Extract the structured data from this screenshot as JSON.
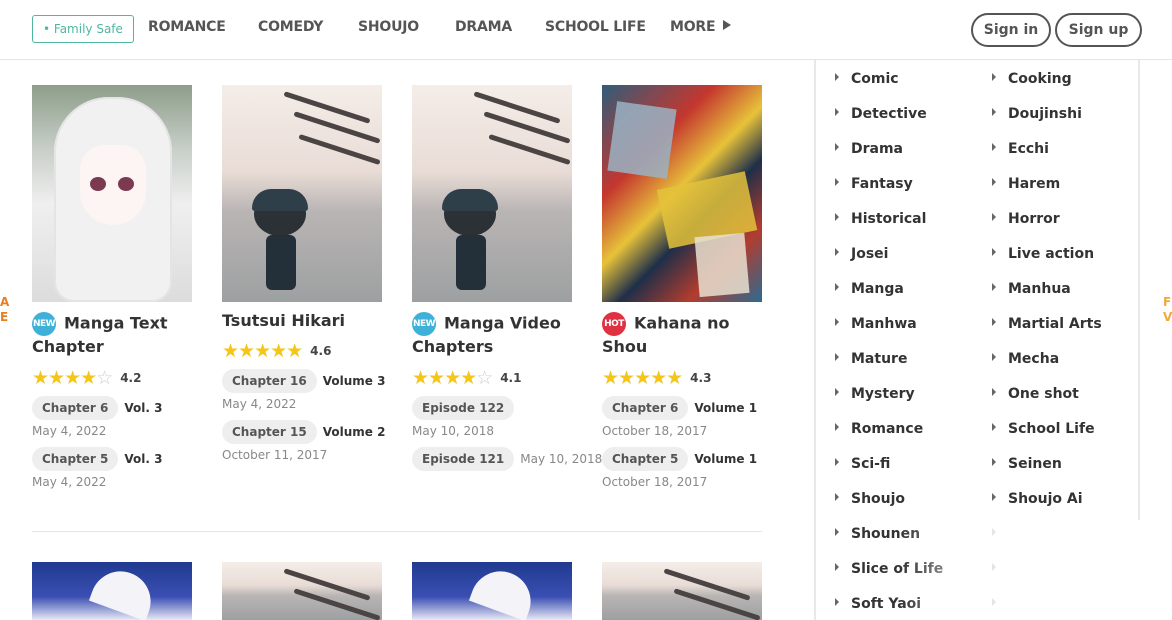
{
  "header": {
    "family_safe": "• Family Safe",
    "nav": [
      "ROMANCE",
      "COMEDY",
      "SHOUJO",
      "DRAMA",
      "SCHOOL LIFE",
      "MORE"
    ],
    "sign_in": "Sign in",
    "sign_up": "Sign up"
  },
  "side_text": {
    "left": [
      "A",
      "E"
    ],
    "right": [
      "F",
      "V"
    ]
  },
  "cards": [
    {
      "badge": "NEW",
      "title": "Manga Text Chapter",
      "rating": 4.2,
      "rating_text": "4.2",
      "chapters": [
        {
          "chip": "Chapter 6",
          "volume": "Vol. 3",
          "date": "May 4, 2022"
        },
        {
          "chip": "Chapter 5",
          "volume": "Vol. 3",
          "date": "May 4, 2022"
        }
      ]
    },
    {
      "badge": "",
      "title": "Tsutsui Hikari",
      "rating": 4.6,
      "rating_text": "4.6",
      "chapters": [
        {
          "chip": "Chapter 16",
          "volume": "Volume 3",
          "date": "May 4, 2022"
        },
        {
          "chip": "Chapter 15",
          "volume": "Volume 2",
          "date": "October 11, 2017"
        }
      ]
    },
    {
      "badge": "NEW",
      "title": "Manga Video Chapters",
      "rating": 4.1,
      "rating_text": "4.1",
      "chapters": [
        {
          "chip": "Episode 122",
          "volume": "",
          "date": "May 10, 2018"
        },
        {
          "chip": "Episode 121",
          "volume": "",
          "date": "May 10, 2018"
        }
      ]
    },
    {
      "badge": "HOT",
      "title": "Kahana no Shou",
      "rating": 4.3,
      "rating_text": "4.3",
      "chapters": [
        {
          "chip": "Chapter 6",
          "volume": "Volume 1",
          "date": "October 18, 2017"
        },
        {
          "chip": "Chapter 5",
          "volume": "Volume 1",
          "date": "October 18, 2017"
        }
      ]
    }
  ],
  "genres": {
    "left": [
      "Comic",
      "Detective",
      "Drama",
      "Fantasy",
      "Historical",
      "Josei",
      "Manga",
      "Manhwa",
      "Mature",
      "Mystery",
      "Romance",
      "Sci-fi",
      "Shoujo",
      "Shounen",
      "Slice of Life",
      "Soft Yaoi"
    ],
    "right": [
      "Cooking",
      "Doujinshi",
      "Ecchi",
      "Harem",
      "Horror",
      "Live action",
      "Manhua",
      "Martial Arts",
      "Mecha",
      "One shot",
      "School Life",
      "Seinen",
      "Shoujo Ai",
      "",
      "",
      ""
    ]
  },
  "icons": {
    "more_arrow": "caret-right-icon",
    "genre_bullet": "caret-right-icon",
    "star": "star-icon"
  },
  "colors": {
    "accent_green": "#4fb79f",
    "new_badge": "#3fb0d8",
    "hot_badge": "#e03142",
    "star": "#f5c518"
  }
}
